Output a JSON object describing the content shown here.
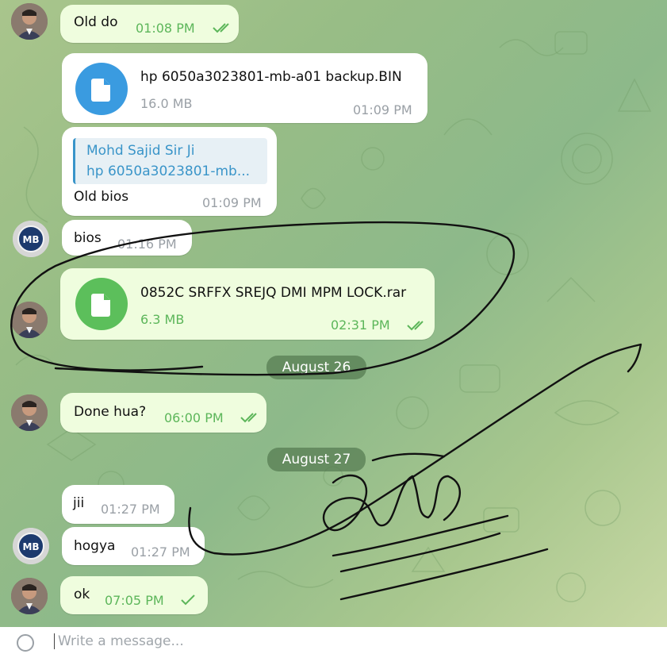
{
  "messages": [
    {
      "id": "m1",
      "text": "Old do",
      "time": "01:08 PM"
    },
    {
      "id": "m2",
      "file_name": "hp 6050a3023801-mb-a01 backup.BIN",
      "file_size": "16.0 MB",
      "time": "01:09 PM"
    },
    {
      "id": "m3",
      "reply_name": "Mohd Sajid Sir Ji",
      "reply_text": "hp 6050a3023801-mb...",
      "text": "Old bios",
      "time": "01:09 PM"
    },
    {
      "id": "m4",
      "text": "bios",
      "time": "01:16 PM"
    },
    {
      "id": "m5",
      "file_name": "0852C SRFFX SREJQ DMI MPM LOCK.rar",
      "file_size": "6.3 MB",
      "time": "02:31 PM"
    },
    {
      "id": "m6",
      "text": "Done hua?",
      "time": "06:00 PM"
    },
    {
      "id": "m7",
      "text": "jii",
      "time": "01:27 PM"
    },
    {
      "id": "m8",
      "text": "hogya",
      "time": "01:27 PM"
    },
    {
      "id": "m9",
      "text": "ok",
      "time": "07:05 PM"
    }
  ],
  "dates": {
    "d1": "August 26",
    "d2": "August 27"
  },
  "avatar_mb": {
    "label": "MB"
  },
  "input": {
    "placeholder": "Write a message..."
  },
  "colors": {
    "file_blue": "#3a9be0",
    "file_green": "#5cbf5b",
    "outgoing_bubble": "#effdde",
    "accent_green": "#5cb65a"
  },
  "icons": [
    "document-icon",
    "double-check-icon",
    "single-check-icon",
    "attach-icon"
  ]
}
